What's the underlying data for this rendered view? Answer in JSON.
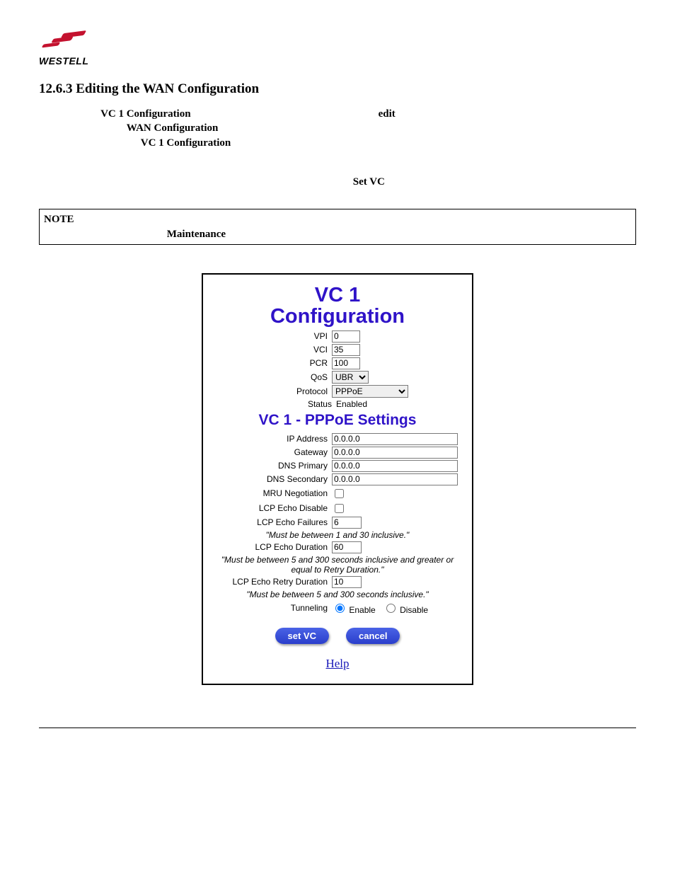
{
  "logo": {
    "wordmark": "WESTELL"
  },
  "heading": "12.6.3  Editing the WAN Configuration",
  "para1": {
    "vc1cfg": "VC 1 Configuration",
    "edit": "edit",
    "wancfg": "WAN Configuration",
    "vc1cfg2": "VC 1 Configuration"
  },
  "para2": {
    "setvc": "Set VC"
  },
  "note": {
    "NOTE": "NOTE",
    "maint": "Maintenance"
  },
  "panel": {
    "title_l1": "VC 1",
    "title_l2": "Configuration",
    "vpi": {
      "label": "VPI",
      "value": "0"
    },
    "vci": {
      "label": "VCI",
      "value": "35"
    },
    "pcr": {
      "label": "PCR",
      "value": "100"
    },
    "qos": {
      "label": "QoS",
      "value": "UBR"
    },
    "protocol": {
      "label": "Protocol",
      "value": "PPPoE"
    },
    "status": {
      "label": "Status",
      "value": "Enabled"
    },
    "sub_title": "VC 1 - PPPoE Settings",
    "ip": {
      "label": "IP Address",
      "value": "0.0.0.0"
    },
    "gw": {
      "label": "Gateway",
      "value": "0.0.0.0"
    },
    "dns1": {
      "label": "DNS Primary",
      "value": "0.0.0.0"
    },
    "dns2": {
      "label": "DNS Secondary",
      "value": "0.0.0.0"
    },
    "mru": {
      "label": "MRU Negotiation"
    },
    "echoDis": {
      "label": "LCP Echo Disable"
    },
    "echoFail": {
      "label": "LCP Echo Failures",
      "value": "6"
    },
    "hint1": "\"Must be between 1 and 30 inclusive.\"",
    "echoDur": {
      "label": "LCP Echo Duration",
      "value": "60"
    },
    "hint2": "\"Must be between 5 and 300 seconds inclusive and greater or equal to Retry Duration.\"",
    "echoRetry": {
      "label": "LCP Echo Retry Duration",
      "value": "10"
    },
    "hint3": "\"Must be between 5 and 300 seconds inclusive.\"",
    "tunnel": {
      "label": "Tunneling",
      "enable": "Enable",
      "disable": "Disable"
    },
    "btn_set": "set VC",
    "btn_cancel": "cancel",
    "help": "Help"
  }
}
